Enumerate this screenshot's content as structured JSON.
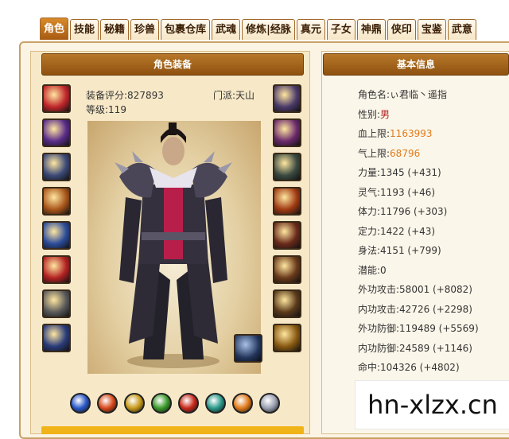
{
  "tabs": [
    "角色",
    "技能",
    "秘籍",
    "珍兽",
    "包裹仓库",
    "武魂",
    "修炼|经脉",
    "真元",
    "子女",
    "神鼎",
    "侠印",
    "宝鉴",
    "武意"
  ],
  "equip_panel": {
    "title": "角色装备",
    "score_label": "装备评分:827893",
    "sect_label": "门派:天山",
    "level_label": "等级:119"
  },
  "left_slots": [
    {
      "icon": "weapon-icon",
      "color": "#c0262a"
    },
    {
      "icon": "bracer-icon",
      "color": "#5a2c8a"
    },
    {
      "icon": "glove-icon",
      "color": "#3c4a78"
    },
    {
      "icon": "belt-icon",
      "color": "#a8561a"
    },
    {
      "icon": "boots-icon",
      "color": "#2c4c9a"
    },
    {
      "icon": "charm-icon",
      "color": "#b22222"
    },
    {
      "icon": "ring-icon",
      "color": "#5a5a5a"
    },
    {
      "icon": "shard-icon",
      "color": "#2a3c7a"
    }
  ],
  "right_slots": [
    {
      "icon": "amulet-icon",
      "color": "#4a3a6a"
    },
    {
      "icon": "pendant-icon",
      "color": "#6a2a6a"
    },
    {
      "icon": "armor-icon",
      "color": "#3a4a40"
    },
    {
      "icon": "feather-icon",
      "color": "#a03a12"
    },
    {
      "icon": "dragon-icon",
      "color": "#6a2a1a"
    },
    {
      "icon": "scroll-icon",
      "color": "#6a3a1a"
    },
    {
      "icon": "talisman-icon",
      "color": "#5a3a1a"
    },
    {
      "icon": "sigil-icon",
      "color": "#8a5a12"
    }
  ],
  "gems": [
    {
      "icon": "blue-gem-icon",
      "color": "#2a58c8"
    },
    {
      "icon": "fire-gem-icon",
      "color": "#d8481a"
    },
    {
      "icon": "blade-gem-icon",
      "color": "#c89a1a"
    },
    {
      "icon": "green-gem-icon",
      "color": "#3a9a2a"
    },
    {
      "icon": "red-gem-icon",
      "color": "#c8281a"
    },
    {
      "icon": "shield-gem-icon",
      "color": "#2a9a8a"
    },
    {
      "icon": "orange-gem-icon",
      "color": "#e07a1a"
    },
    {
      "icon": "white-gem-icon",
      "color": "#9aa0b0"
    }
  ],
  "basic_info": {
    "title": "基本信息",
    "stats": [
      {
        "label": "角色名:",
        "value": "ぃ君临丶遥指",
        "color": "#333333"
      },
      {
        "label": "性别:",
        "value": "男",
        "color": "#b22222"
      },
      {
        "label": "血上限:",
        "value": "1163993",
        "color": "#e07a1a"
      },
      {
        "label": "气上限:",
        "value": "68796",
        "color": "#e07a1a"
      },
      {
        "label": "力量:",
        "value": "1345 (+431)",
        "color": "#333333"
      },
      {
        "label": "灵气:",
        "value": "1193 (+46)",
        "color": "#333333"
      },
      {
        "label": "体力:",
        "value": "11796 (+303)",
        "color": "#333333"
      },
      {
        "label": "定力:",
        "value": "1422 (+43)",
        "color": "#333333"
      },
      {
        "label": "身法:",
        "value": "4151 (+799)",
        "color": "#333333"
      },
      {
        "label": "潜能:",
        "value": "0",
        "color": "#333333"
      },
      {
        "label": "外功攻击:",
        "value": "58001 (+8082)",
        "color": "#333333"
      },
      {
        "label": "内功攻击:",
        "value": "42726 (+2298)",
        "color": "#333333"
      },
      {
        "label": "外功防御:",
        "value": "119489 (+5569)",
        "color": "#333333"
      },
      {
        "label": "内功防御:",
        "value": "24589 (+1146)",
        "color": "#333333"
      },
      {
        "label": "命中:",
        "value": "104326 (+4802)",
        "color": "#333333"
      }
    ]
  },
  "watermark": "hn-xlzx.cn"
}
